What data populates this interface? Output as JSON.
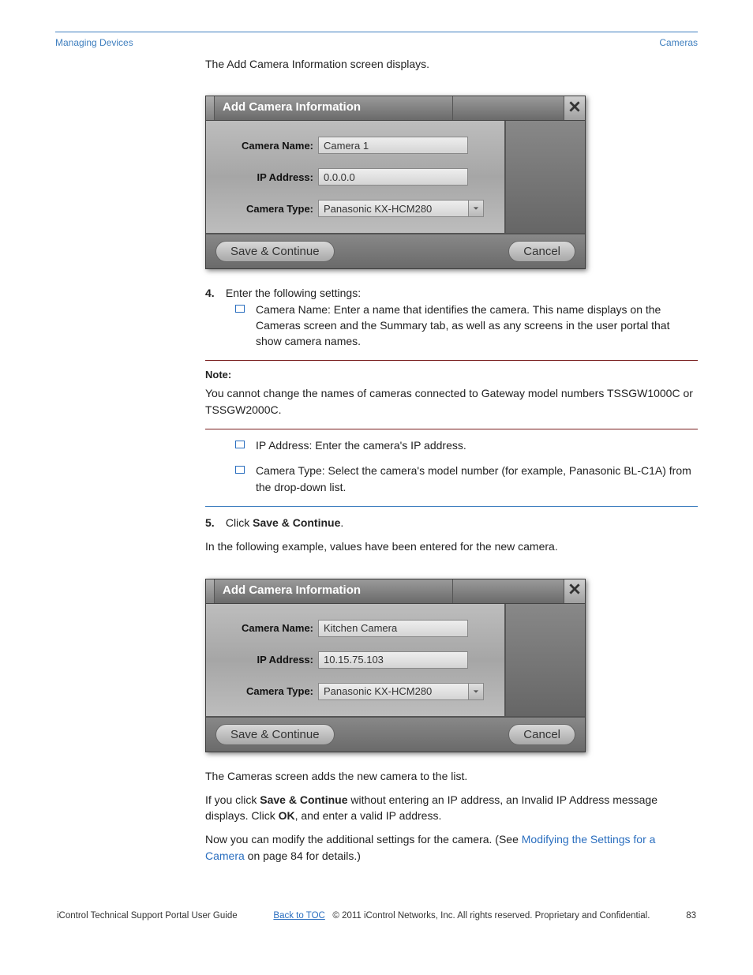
{
  "header": {
    "breadcrumb_left": "Managing Devices",
    "breadcrumb_right": "Cameras"
  },
  "step3": {
    "intro": "The Add Camera Information screen displays.",
    "dialog_title": "Add Camera Information",
    "fields": {
      "name_label": "Camera Name:",
      "name_value": "Camera 1",
      "ip_label": "IP Address:",
      "ip_value": "0.0.0.0",
      "type_label": "Camera Type:",
      "type_value": "Panasonic KX-HCM280"
    },
    "save_btn": "Save & Continue",
    "cancel_btn": "Cancel"
  },
  "num4": "4.",
  "instr4": "Enter the following settings:",
  "bullets_a": {
    "name": "Camera Name: Enter a name that identifies the camera. This name displays on the Cameras screen and the Summary tab, as well as any screens in the user portal that show camera names."
  },
  "note_label": "Note:",
  "note_text": "You cannot change the names of cameras connected to Gateway model numbers TSSGW1000C or TSSGW2000C.",
  "bullets_b": {
    "ip": "IP Address: Enter the camera's IP address.",
    "type": "Camera Type: Select the camera's model number (for example, Panasonic BL-C1A) from the drop-down list."
  },
  "num5": "5.",
  "instr5": "Click Save & Continue.",
  "step5": {
    "intro": "In the following example, values have been entered for the new camera.",
    "dialog_title": "Add Camera Information",
    "fields": {
      "name_label": "Camera Name:",
      "name_value": "Kitchen Camera",
      "ip_label": "IP Address:",
      "ip_value": "10.15.75.103",
      "type_label": "Camera Type:",
      "type_value": "Panasonic KX-HCM280"
    },
    "save_btn": "Save & Continue",
    "cancel_btn": "Cancel"
  },
  "after": {
    "p1": "The Cameras screen adds the new camera to the list.",
    "p2_a": "If you click ",
    "p2_b": "Save & Continue",
    "p2_c": " without entering an IP address, an Invalid IP Address message displays. Click ",
    "p2_d": "OK",
    "p2_e": ", and enter a valid IP address.",
    "p3_a": "Now you can modify the additional settings for the camera. (See ",
    "p3_link": " Modifying the Settings for a Camera",
    "p3_b": " on page 84 for details.)"
  },
  "footer": {
    "left": "iControl Technical Support Portal User Guide",
    "link_text": "Back to TOC",
    "center": "© 2011 iControl Networks, Inc. All rights reserved. Proprietary and Confidential.",
    "right": "83"
  }
}
